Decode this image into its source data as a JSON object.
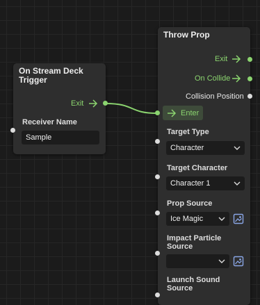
{
  "stream_deck_node": {
    "title": "On Stream Deck Trigger",
    "exit_label": "Exit",
    "receiver_label": "Receiver Name",
    "receiver_value": "Sample"
  },
  "throw_prop_node": {
    "title": "Throw Prop",
    "exit_label": "Exit",
    "on_collide_label": "On Collide",
    "collision_position_label": "Collision Position",
    "enter_label": "Enter",
    "target_type_label": "Target Type",
    "target_type_value": "Character",
    "target_character_label": "Target Character",
    "target_character_value": "Character 1",
    "prop_source_label": "Prop Source",
    "prop_source_value": "Ice Magic",
    "impact_particle_label": "Impact Particle Source",
    "impact_particle_value": "",
    "launch_sound_label": "Launch Sound Source"
  },
  "colors": {
    "canvas": "#1b1b1b",
    "node": "#2e2e2e",
    "accent_green": "#8bd46f",
    "asset_blue": "#8aa6e6"
  },
  "icons": [
    "arrow-right-icon",
    "chevron-down-icon",
    "asset-picker-icon"
  ]
}
